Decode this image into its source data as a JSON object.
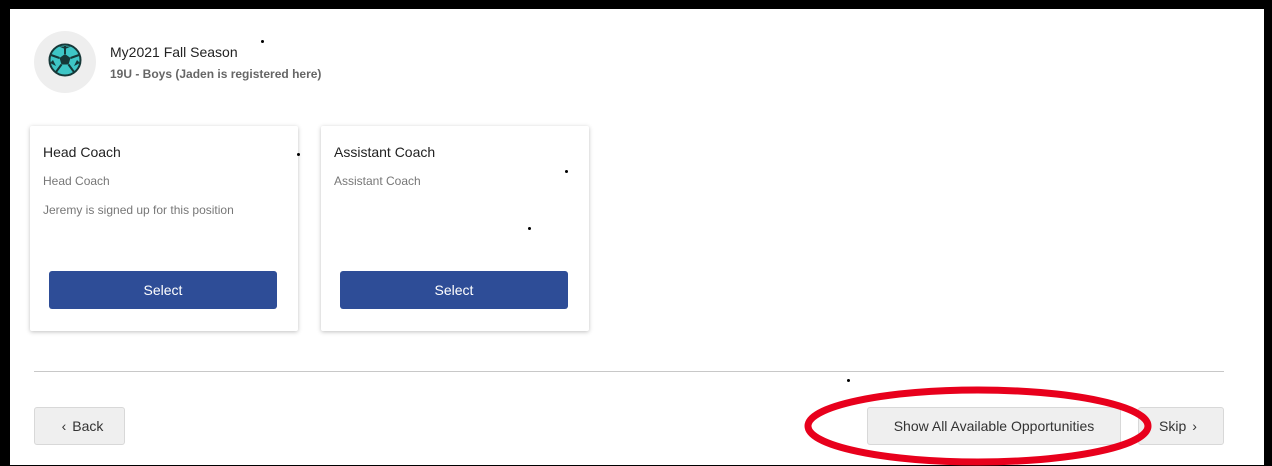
{
  "season": {
    "title": "My2021 Fall Season",
    "subtitle": "19U - Boys (Jaden is registered here)",
    "icon": "soccer-ball-icon"
  },
  "positions": [
    {
      "title": "Head Coach",
      "subtitle": "Head Coach",
      "note": "Jeremy is signed up for this position",
      "button_label": "Select"
    },
    {
      "title": "Assistant Coach",
      "subtitle": "Assistant Coach",
      "note": "",
      "button_label": "Select"
    }
  ],
  "footer": {
    "back_label": "Back",
    "show_all_label": "Show All Available Opportunities",
    "skip_label": "Skip"
  },
  "colors": {
    "select_button": "#2e4d97",
    "annotation_ellipse": "#e8001c",
    "soccer_ball": "#3ec6c6"
  }
}
